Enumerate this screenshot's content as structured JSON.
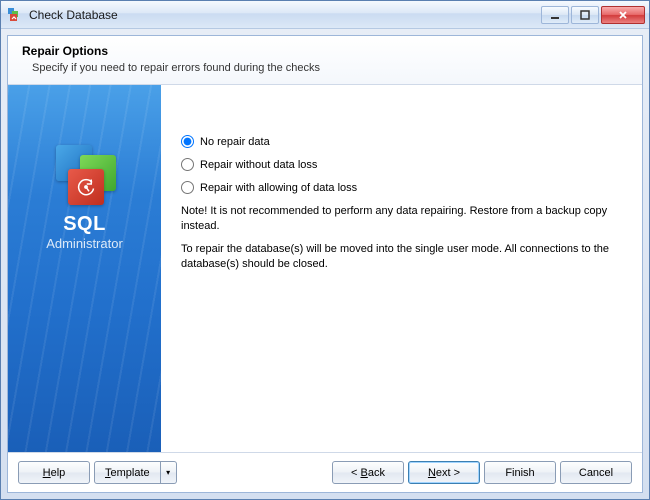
{
  "window": {
    "title": "Check Database"
  },
  "header": {
    "title": "Repair Options",
    "subtitle": "Specify if you need to repair errors found during the checks"
  },
  "sidebar": {
    "product_name": "SQL",
    "product_sub": "Administrator"
  },
  "options": {
    "opt1": "No repair data",
    "opt2": "Repair without data loss",
    "opt3": "Repair with allowing of data loss",
    "selected": "opt1"
  },
  "notes": {
    "note1": "Note! It is not recommended to perform any data repairing. Restore from a backup copy instead.",
    "note2": "To repair the database(s) will be moved into the single user mode. All connections to the database(s) should be closed."
  },
  "buttons": {
    "help": "Help",
    "template": "Template",
    "back": "< Back",
    "next": "Next >",
    "finish": "Finish",
    "cancel": "Cancel"
  }
}
